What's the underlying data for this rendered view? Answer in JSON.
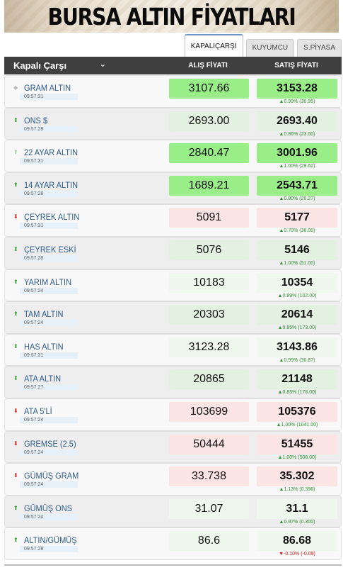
{
  "banner": {
    "title": "BURSA ALTIN FİYATLARI"
  },
  "tabs": [
    {
      "label": "KAPALIÇARŞI",
      "active": true
    },
    {
      "label": "KUYUMCU",
      "active": false
    },
    {
      "label": "S.PİYASA",
      "active": false
    }
  ],
  "header": {
    "market": "Kapalı Çarşı",
    "buy_label": "ALIŞ FİYATI",
    "sell_label": "SATIŞ FİYATI"
  },
  "rows": [
    {
      "name": "GRAM ALTIN",
      "time": "09:57:31",
      "trend": "neutral",
      "buy": "3107.66",
      "sell": "3153.28",
      "buy_bg": "up-strong",
      "sell_bg": "up-strong",
      "change": "▲0.99% (30.95)",
      "change_dir": "pos"
    },
    {
      "name": "ONS $",
      "time": "09:57:28",
      "trend": "up",
      "buy": "2693.00",
      "sell": "2693.40",
      "buy_bg": "up-light",
      "sell_bg": "up-light",
      "change": "▲0.86% (23.00)",
      "change_dir": "pos"
    },
    {
      "name": "22 AYAR ALTIN",
      "time": "09:57:31",
      "trend": "up-faint",
      "buy": "2840.47",
      "sell": "3001.96",
      "buy_bg": "up-strong",
      "sell_bg": "up-strong",
      "change": "▲1.00% (29.62)",
      "change_dir": "pos"
    },
    {
      "name": "14 AYAR ALTIN",
      "time": "09:57:28",
      "trend": "up",
      "buy": "1689.21",
      "sell": "2543.71",
      "buy_bg": "up-strong",
      "sell_bg": "up-strong",
      "change": "▲0.80% (20.27)",
      "change_dir": "pos"
    },
    {
      "name": "ÇEYREK ALTIN",
      "time": "09:57:31",
      "trend": "down",
      "buy": "5091",
      "sell": "5177",
      "buy_bg": "down",
      "sell_bg": "down",
      "change": "▲0.70% (36.00)",
      "change_dir": "pos"
    },
    {
      "name": "ÇEYREK ESKİ",
      "time": "09:57:28",
      "trend": "up",
      "buy": "5076",
      "sell": "5146",
      "buy_bg": "up-light",
      "sell_bg": "up-light",
      "change": "▲1.00% (51.00)",
      "change_dir": "pos"
    },
    {
      "name": "YARIM ALTIN",
      "time": "09:57:24",
      "trend": "up",
      "buy": "10183",
      "sell": "10354",
      "buy_bg": "up-pale",
      "sell_bg": "up-pale",
      "change": "▲0.99% (102.00)",
      "change_dir": "pos"
    },
    {
      "name": "TAM ALTIN",
      "time": "09:57:24",
      "trend": "up",
      "buy": "20303",
      "sell": "20614",
      "buy_bg": "up-light",
      "sell_bg": "up-light",
      "change": "▲0.85% (173.00)",
      "change_dir": "pos"
    },
    {
      "name": "HAS ALTIN",
      "time": "09:57:31",
      "trend": "up",
      "buy": "3123.28",
      "sell": "3143.86",
      "buy_bg": "up-pale",
      "sell_bg": "up-pale",
      "change": "▲0.99% (30.87)",
      "change_dir": "pos"
    },
    {
      "name": "ATA ALTIN",
      "time": "09:57:27",
      "trend": "up",
      "buy": "20865",
      "sell": "21148",
      "buy_bg": "up-light",
      "sell_bg": "up-light",
      "change": "▲0.85% (178.00)",
      "change_dir": "pos"
    },
    {
      "name": "ATA 5'Lİ",
      "time": "09:57:24",
      "trend": "down",
      "buy": "103699",
      "sell": "105376",
      "buy_bg": "down",
      "sell_bg": "down",
      "change": "▲1.00% (1041.00)",
      "change_dir": "pos"
    },
    {
      "name": "GREMSE (2.5)",
      "time": "09:57:24",
      "trend": "down",
      "buy": "50444",
      "sell": "51455",
      "buy_bg": "down",
      "sell_bg": "down",
      "change": "▲1.00% (508.00)",
      "change_dir": "pos"
    },
    {
      "name": "GÜMÜŞ GRAM",
      "time": "09:57:24",
      "trend": "down",
      "buy": "33.738",
      "sell": "35.302",
      "buy_bg": "down",
      "sell_bg": "down",
      "change": "▲1.13% (0.396)",
      "change_dir": "pos"
    },
    {
      "name": "GÜMÜŞ ONS",
      "time": "09:57:24",
      "trend": "up",
      "buy": "31.07",
      "sell": "31.1",
      "buy_bg": "up-pale",
      "sell_bg": "up-pale",
      "change": "▲0.97% (0.300)",
      "change_dir": "pos"
    },
    {
      "name": "ALTIN/GÜMÜŞ",
      "time": "09:57:28",
      "trend": "up",
      "buy": "86.6",
      "sell": "86.68",
      "buy_bg": "up-pale",
      "sell_bg": "up-pale",
      "change": "▼-0.10% (-0.09)",
      "change_dir": "neg"
    }
  ]
}
